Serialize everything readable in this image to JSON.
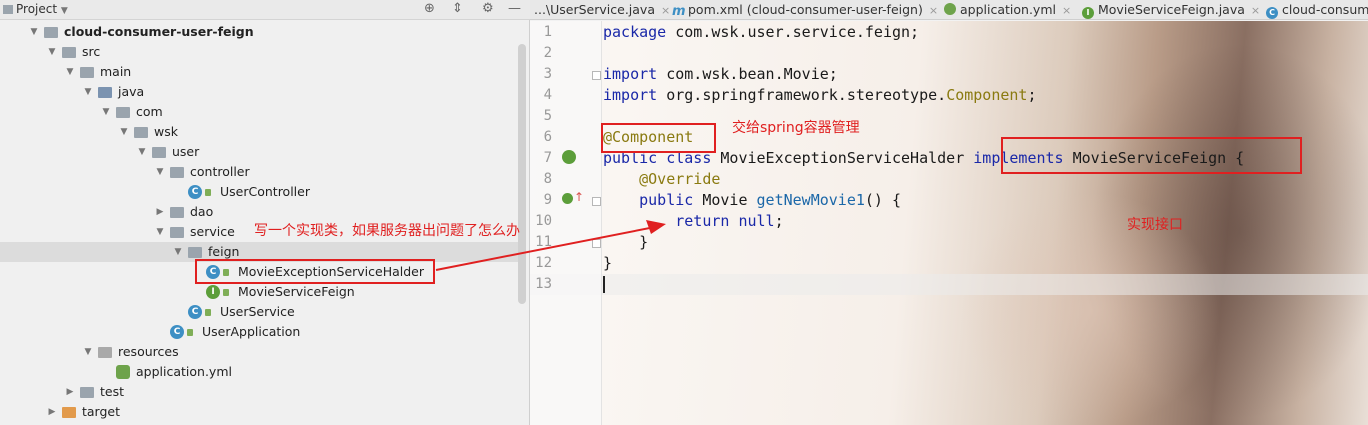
{
  "panel": {
    "title": "Project",
    "title_icon": "project-folder-icon",
    "tools": [
      "locate-icon",
      "collapse-icon",
      "gear-icon",
      "hide-icon"
    ]
  },
  "tree": [
    {
      "label": "cloud-consumer-user-feign",
      "indent": 0,
      "kind": "folder-module",
      "expanded": true,
      "bold": true
    },
    {
      "label": "src",
      "indent": 1,
      "kind": "folder",
      "expanded": true
    },
    {
      "label": "main",
      "indent": 2,
      "kind": "folder",
      "expanded": true
    },
    {
      "label": "java",
      "indent": 3,
      "kind": "folder-blue",
      "expanded": true
    },
    {
      "label": "com",
      "indent": 4,
      "kind": "folder",
      "expanded": true
    },
    {
      "label": "wsk",
      "indent": 5,
      "kind": "folder",
      "expanded": true
    },
    {
      "label": "user",
      "indent": 6,
      "kind": "folder",
      "expanded": true
    },
    {
      "label": "controller",
      "indent": 7,
      "kind": "folder",
      "expanded": true
    },
    {
      "label": "UserController",
      "indent": 8,
      "kind": "class"
    },
    {
      "label": "dao",
      "indent": 7,
      "kind": "folder",
      "expanded": false
    },
    {
      "label": "service",
      "indent": 7,
      "kind": "folder",
      "expanded": true
    },
    {
      "label": "feign",
      "indent": 8,
      "kind": "folder",
      "expanded": true,
      "selected": true
    },
    {
      "label": "MovieExceptionServiceHalder",
      "indent": 9,
      "kind": "class"
    },
    {
      "label": "MovieServiceFeign",
      "indent": 9,
      "kind": "interface"
    },
    {
      "label": "UserService",
      "indent": 8,
      "kind": "class"
    },
    {
      "label": "UserApplication",
      "indent": 7,
      "kind": "class-app"
    },
    {
      "label": "resources",
      "indent": 3,
      "kind": "folder-gray",
      "expanded": true
    },
    {
      "label": "application.yml",
      "indent": 4,
      "kind": "yml"
    },
    {
      "label": "test",
      "indent": 2,
      "kind": "folder",
      "expanded": false
    },
    {
      "label": "target",
      "indent": 1,
      "kind": "folder-orange",
      "expanded": false
    }
  ],
  "tabs": [
    {
      "label": "...\\UserService.java",
      "icon": "",
      "color": "#3d8fc4"
    },
    {
      "label": "pom.xml (cloud-consumer-user-feign)",
      "icon": "m",
      "color": "#3d8fc4"
    },
    {
      "label": "application.yml",
      "icon": "",
      "color": "#6ea34b"
    },
    {
      "label": "MovieServiceFeign.java",
      "icon": "I",
      "color": "#5c9e3a"
    },
    {
      "label": "cloud-consume",
      "icon": "C",
      "color": "#3d8fc4"
    }
  ],
  "code_lines": [
    {
      "no": "1",
      "tokens": [
        {
          "t": "package ",
          "c": "kw"
        },
        {
          "t": "com.wsk.user.service.feign;",
          "c": ""
        }
      ]
    },
    {
      "no": "2",
      "tokens": []
    },
    {
      "no": "3",
      "tokens": [
        {
          "t": "import ",
          "c": "kw"
        },
        {
          "t": "com.wsk.bean.Movie;",
          "c": ""
        }
      ]
    },
    {
      "no": "4",
      "tokens": [
        {
          "t": "import ",
          "c": "kw"
        },
        {
          "t": "org.springframework.stereotype.",
          "c": ""
        },
        {
          "t": "Component",
          "c": "type-hl"
        },
        {
          "t": ";",
          "c": ""
        }
      ]
    },
    {
      "no": "5",
      "tokens": []
    },
    {
      "no": "6",
      "tokens": [
        {
          "t": "@Component",
          "c": "ann"
        }
      ]
    },
    {
      "no": "7",
      "tokens": [
        {
          "t": "public class ",
          "c": "kw"
        },
        {
          "t": "MovieExceptionServiceHalder ",
          "c": ""
        },
        {
          "t": "implements ",
          "c": "kw"
        },
        {
          "t": "MovieServiceFeign {",
          "c": ""
        }
      ]
    },
    {
      "no": "8",
      "tokens": [
        {
          "t": "    ",
          "c": ""
        },
        {
          "t": "@Override",
          "c": "ann"
        }
      ]
    },
    {
      "no": "9",
      "tokens": [
        {
          "t": "    ",
          "c": ""
        },
        {
          "t": "public ",
          "c": "kw"
        },
        {
          "t": "Movie ",
          "c": ""
        },
        {
          "t": "getNewMovie1",
          "c": "meth"
        },
        {
          "t": "() {",
          "c": ""
        }
      ]
    },
    {
      "no": "10",
      "tokens": [
        {
          "t": "        ",
          "c": ""
        },
        {
          "t": "return null",
          "c": "kw"
        },
        {
          "t": ";",
          "c": ""
        }
      ]
    },
    {
      "no": "11",
      "tokens": [
        {
          "t": "    }",
          "c": ""
        }
      ]
    },
    {
      "no": "12",
      "tokens": [
        {
          "t": "}",
          "c": ""
        }
      ]
    },
    {
      "no": "13",
      "tokens": []
    }
  ],
  "annotations": {
    "note_component": "交给spring容器管理",
    "note_impl_class": "写一个实现类，如果服务器出问题了怎么办",
    "note_interface": "实现接口"
  }
}
